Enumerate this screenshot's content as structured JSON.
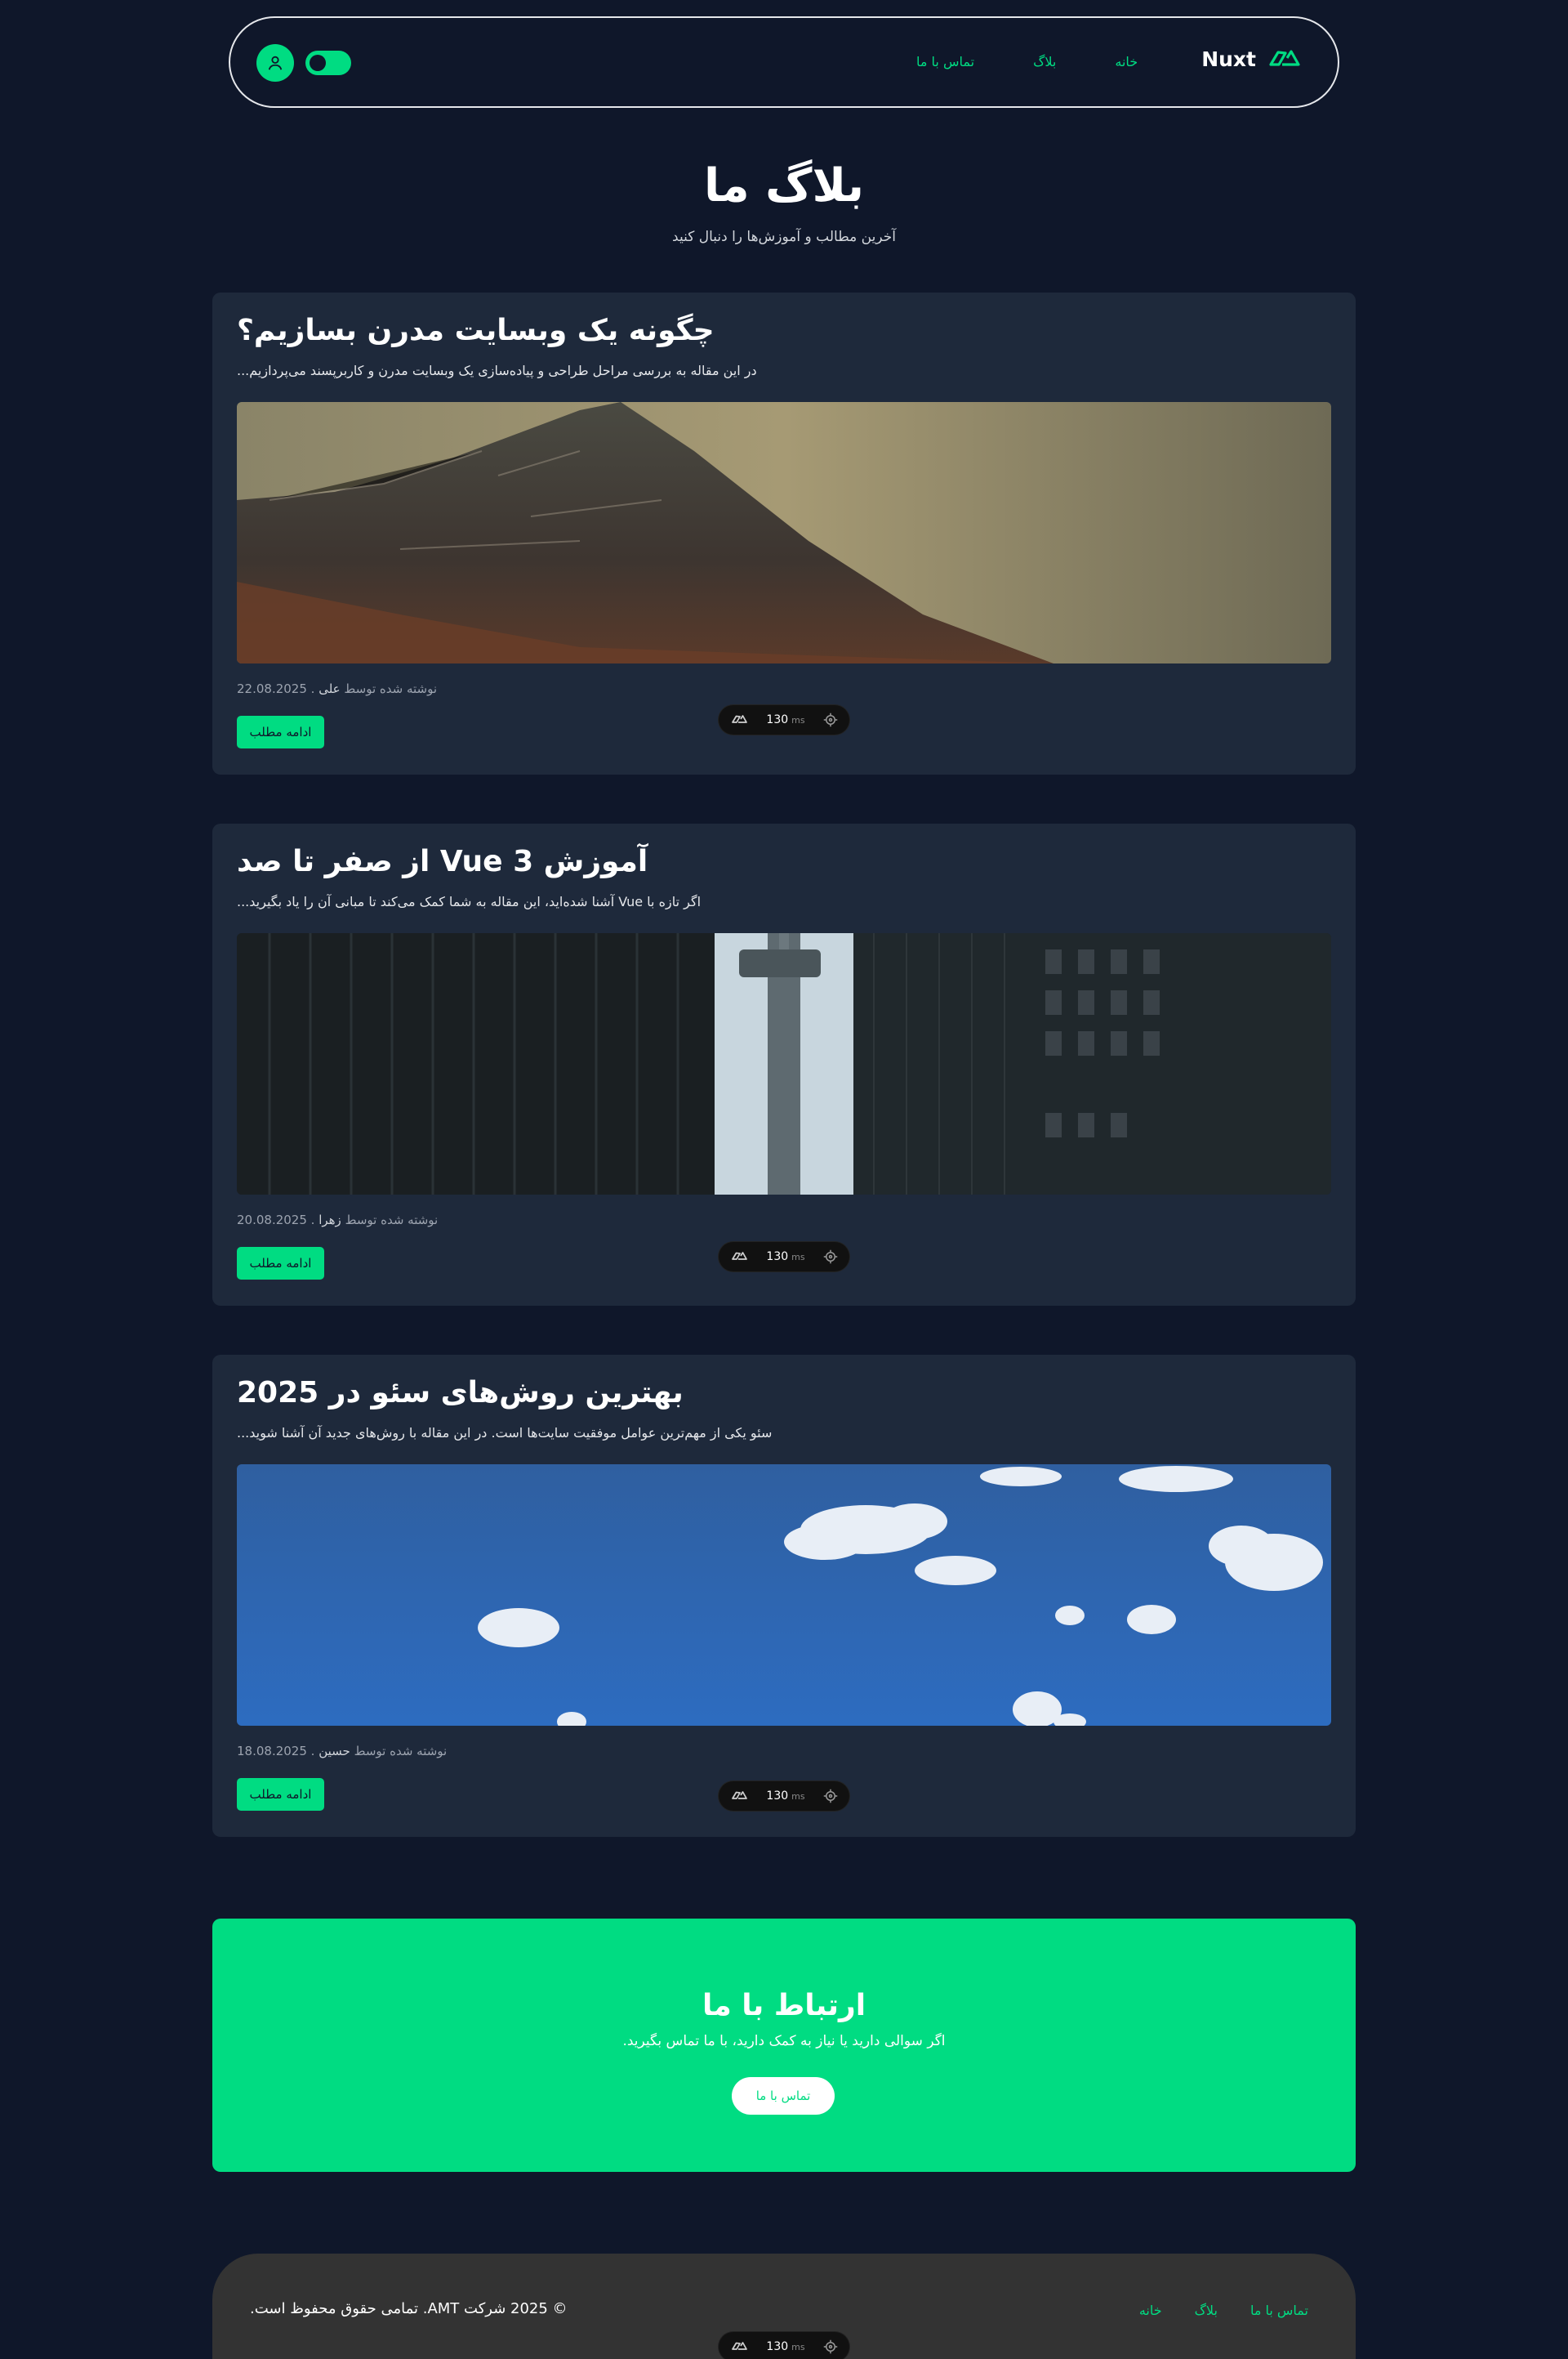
{
  "header": {
    "brand": "Nuxt",
    "nav": [
      "خانه",
      "بلاگ",
      "تماس با ما"
    ]
  },
  "hero": {
    "title": "بلاگ ما",
    "subtitle": "آخرین مطالب و آموزش‌ها را دنبال کنید"
  },
  "posts": [
    {
      "title": "چگونه یک وبسایت مدرن بسازیم؟",
      "excerpt": "در این مقاله به بررسی مراحل طراحی و پیاده‌سازی یک وبسایت مدرن و کاربرپسند می‌پردازیم...",
      "meta_prefix": "نوشته شده توسط",
      "author": "علی",
      "date": "22.08.2025",
      "button": "ادامه مطلب"
    },
    {
      "title": "آموزش Vue 3 از صفر تا صد",
      "excerpt": "اگر تازه با Vue آشنا شده‌اید، این مقاله به شما کمک می‌کند تا مبانی آن را یاد بگیرید...",
      "meta_prefix": "نوشته شده توسط",
      "author": "زهرا",
      "date": "20.08.2025",
      "button": "ادامه مطلب"
    },
    {
      "title": "بهترین روش‌های سئو در 2025",
      "excerpt": "سئو یکی از مهم‌ترین عوامل موفقیت سایت‌ها است. در این مقاله با روش‌های جدید آن آشنا شوید...",
      "meta_prefix": "نوشته شده توسط",
      "author": "حسین",
      "date": "18.08.2025",
      "button": "ادامه مطلب"
    }
  ],
  "devtools": {
    "ms": "130",
    "unit": "ms"
  },
  "cta": {
    "title": "ارتباط با ما",
    "text": "اگر سوالی دارید یا نیاز به کمک دارید، با ما تماس بگیرید.",
    "button": "تماس با ما"
  },
  "footer": {
    "links": [
      "تماس با ما",
      "بلاگ",
      "خانه"
    ],
    "copyright": "© 2025 شرکت AMT. تمامی حقوق محفوظ است."
  },
  "colors": {
    "accent": "#00dc82",
    "background": "#0f172a",
    "card": "#1e293b",
    "footer": "#333333"
  }
}
